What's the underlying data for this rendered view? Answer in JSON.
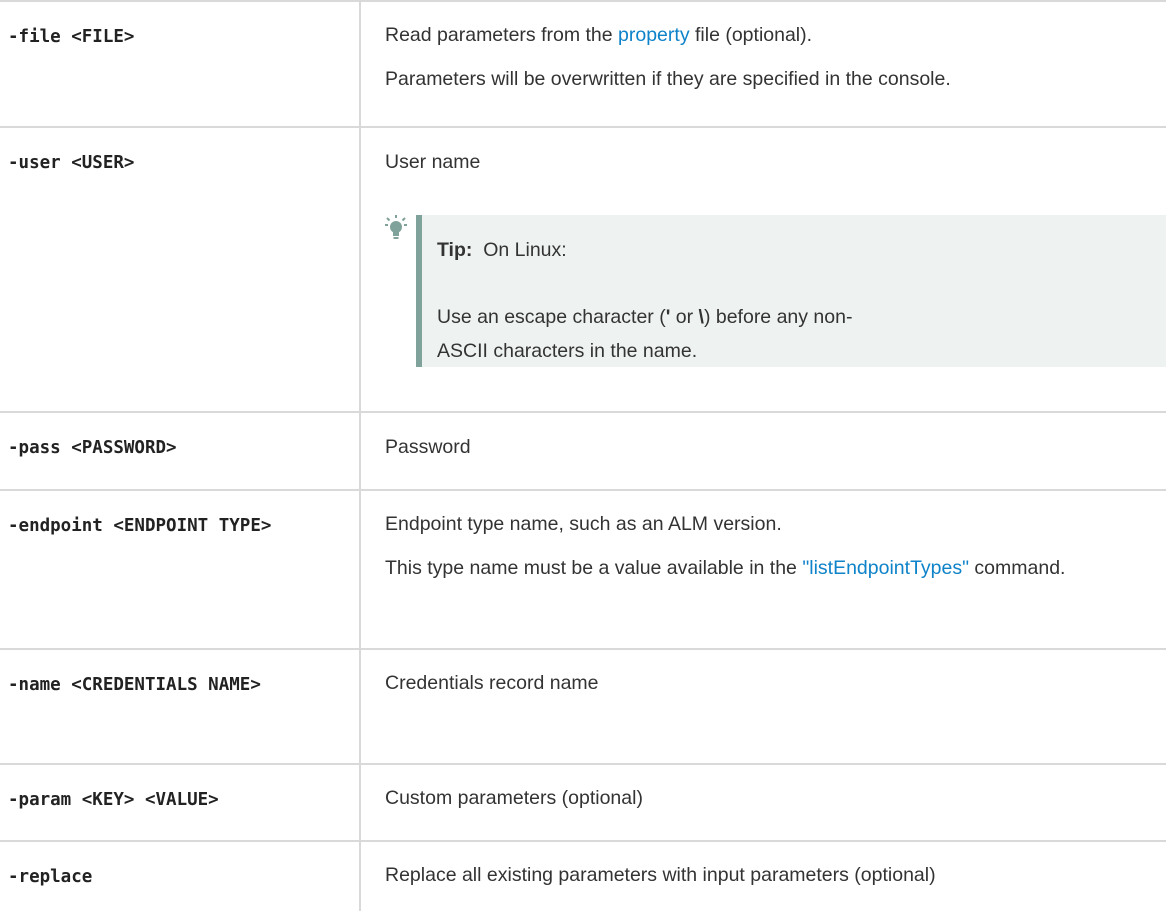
{
  "rows": [
    {
      "option": "-file <FILE>",
      "desc_lines": [
        {
          "before": "Read parameters from the ",
          "link": "property",
          "after": " file (optional)."
        },
        {
          "text": "Parameters will be overwritten if they are specified in the console."
        }
      ]
    },
    {
      "option": "-user <USER>",
      "desc": "User name",
      "tip": {
        "label": "Tip:",
        "heading": "On Linux:",
        "body_before": "Use an escape character (",
        "quote_char": "'",
        "body_or": " or ",
        "backslash_char": "\\",
        "body_after": ") before any non-ASCII characters in the name."
      }
    },
    {
      "option": "-pass <PASSWORD>",
      "desc": "Password"
    },
    {
      "option": "-endpoint <ENDPOINT TYPE>",
      "desc_line1": "Endpoint type name, such as an ALM version.",
      "desc_line2_before": "This type name must be a value available in the ",
      "desc_line2_link": "\"listEndpointTypes\"",
      "desc_line2_after": " command."
    },
    {
      "option": "-name <CREDENTIALS NAME>",
      "desc": "Credentials record name"
    },
    {
      "option": "-param <KEY> <VALUE>",
      "desc": "Custom parameters (optional)"
    },
    {
      "option": "-replace",
      "desc": "Replace all existing parameters with input parameters (optional)"
    }
  ],
  "colors": {
    "link": "#0e83c9",
    "tip_background": "#eef3f2",
    "tip_border": "#7fa39a",
    "grid": "#d9d9d9"
  },
  "icons": {
    "tip": "lightbulb-icon"
  }
}
